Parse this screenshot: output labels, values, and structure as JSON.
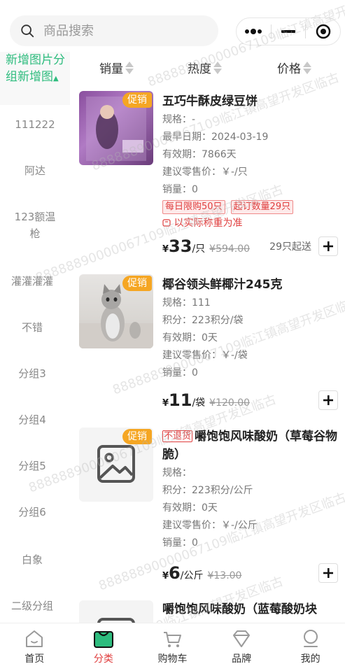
{
  "search": {
    "placeholder": "商品搜索"
  },
  "sidebar": {
    "items": [
      {
        "label": "新增图片分组新增图",
        "active": true
      },
      {
        "label": "111222"
      },
      {
        "label": "阿达"
      },
      {
        "label": "123额温枪"
      },
      {
        "label": "灌灌灌灌"
      },
      {
        "label": "不错"
      },
      {
        "label": "分组3"
      },
      {
        "label": "分组4"
      },
      {
        "label": "分组5"
      },
      {
        "label": "分组6"
      },
      {
        "label": "白象"
      },
      {
        "label": "二级分组"
      }
    ]
  },
  "sort": {
    "sales": "销量",
    "heat": "热度",
    "price": "价格"
  },
  "products": [
    {
      "name": "五巧牛酥皮绿豆饼",
      "promo": "促销",
      "spec": "规格：-",
      "date": "最早日期：2024-03-19",
      "validity": "有效期：7866天",
      "retail": "建议零售价：￥-/只",
      "sales": "销量：0",
      "tags": [
        "每日限购50只",
        "起订数量29只"
      ],
      "note": "以实际称重为准",
      "yen": "¥",
      "price": "33",
      "unit": "/只",
      "old": "¥594.00",
      "minq": "29只起送"
    },
    {
      "name": "椰谷领头鲜椰汁245克",
      "promo": "促销",
      "spec": "规格：111",
      "points": "积分：223积分/袋",
      "validity": "有效期：0天",
      "retail": "建议零售价：￥-/袋",
      "sales": "销量：0",
      "yen": "¥",
      "price": "11",
      "unit": "/袋",
      "old": "¥120.00"
    },
    {
      "name": "嚼饱饱风味酸奶（草莓谷物脆）",
      "badge": "不退货",
      "promo": "促销",
      "spec": "规格：",
      "points": "积分：223积分/公斤",
      "validity": "有效期：0天",
      "retail": "建议零售价：￥-/公斤",
      "sales": "销量：0",
      "yen": "¥",
      "price": "6",
      "unit": "/公斤",
      "old": "¥13.00"
    },
    {
      "name": "嚼饱饱风味酸奶（蓝莓酸奶块"
    }
  ],
  "watermark": "8888889000006710​9临江镇高望开发区临古",
  "tabbar": {
    "items": [
      {
        "label": "首页",
        "icon": "home-icon"
      },
      {
        "label": "分类",
        "icon": "category-icon",
        "active": true
      },
      {
        "label": "购物车",
        "icon": "cart-icon"
      },
      {
        "label": "品牌",
        "icon": "brand-icon"
      },
      {
        "label": "我的",
        "icon": "profile-icon"
      }
    ]
  },
  "colors": {
    "accent": "#2ebc7e",
    "promo": "#f5a623",
    "red": "#e03e3e"
  }
}
